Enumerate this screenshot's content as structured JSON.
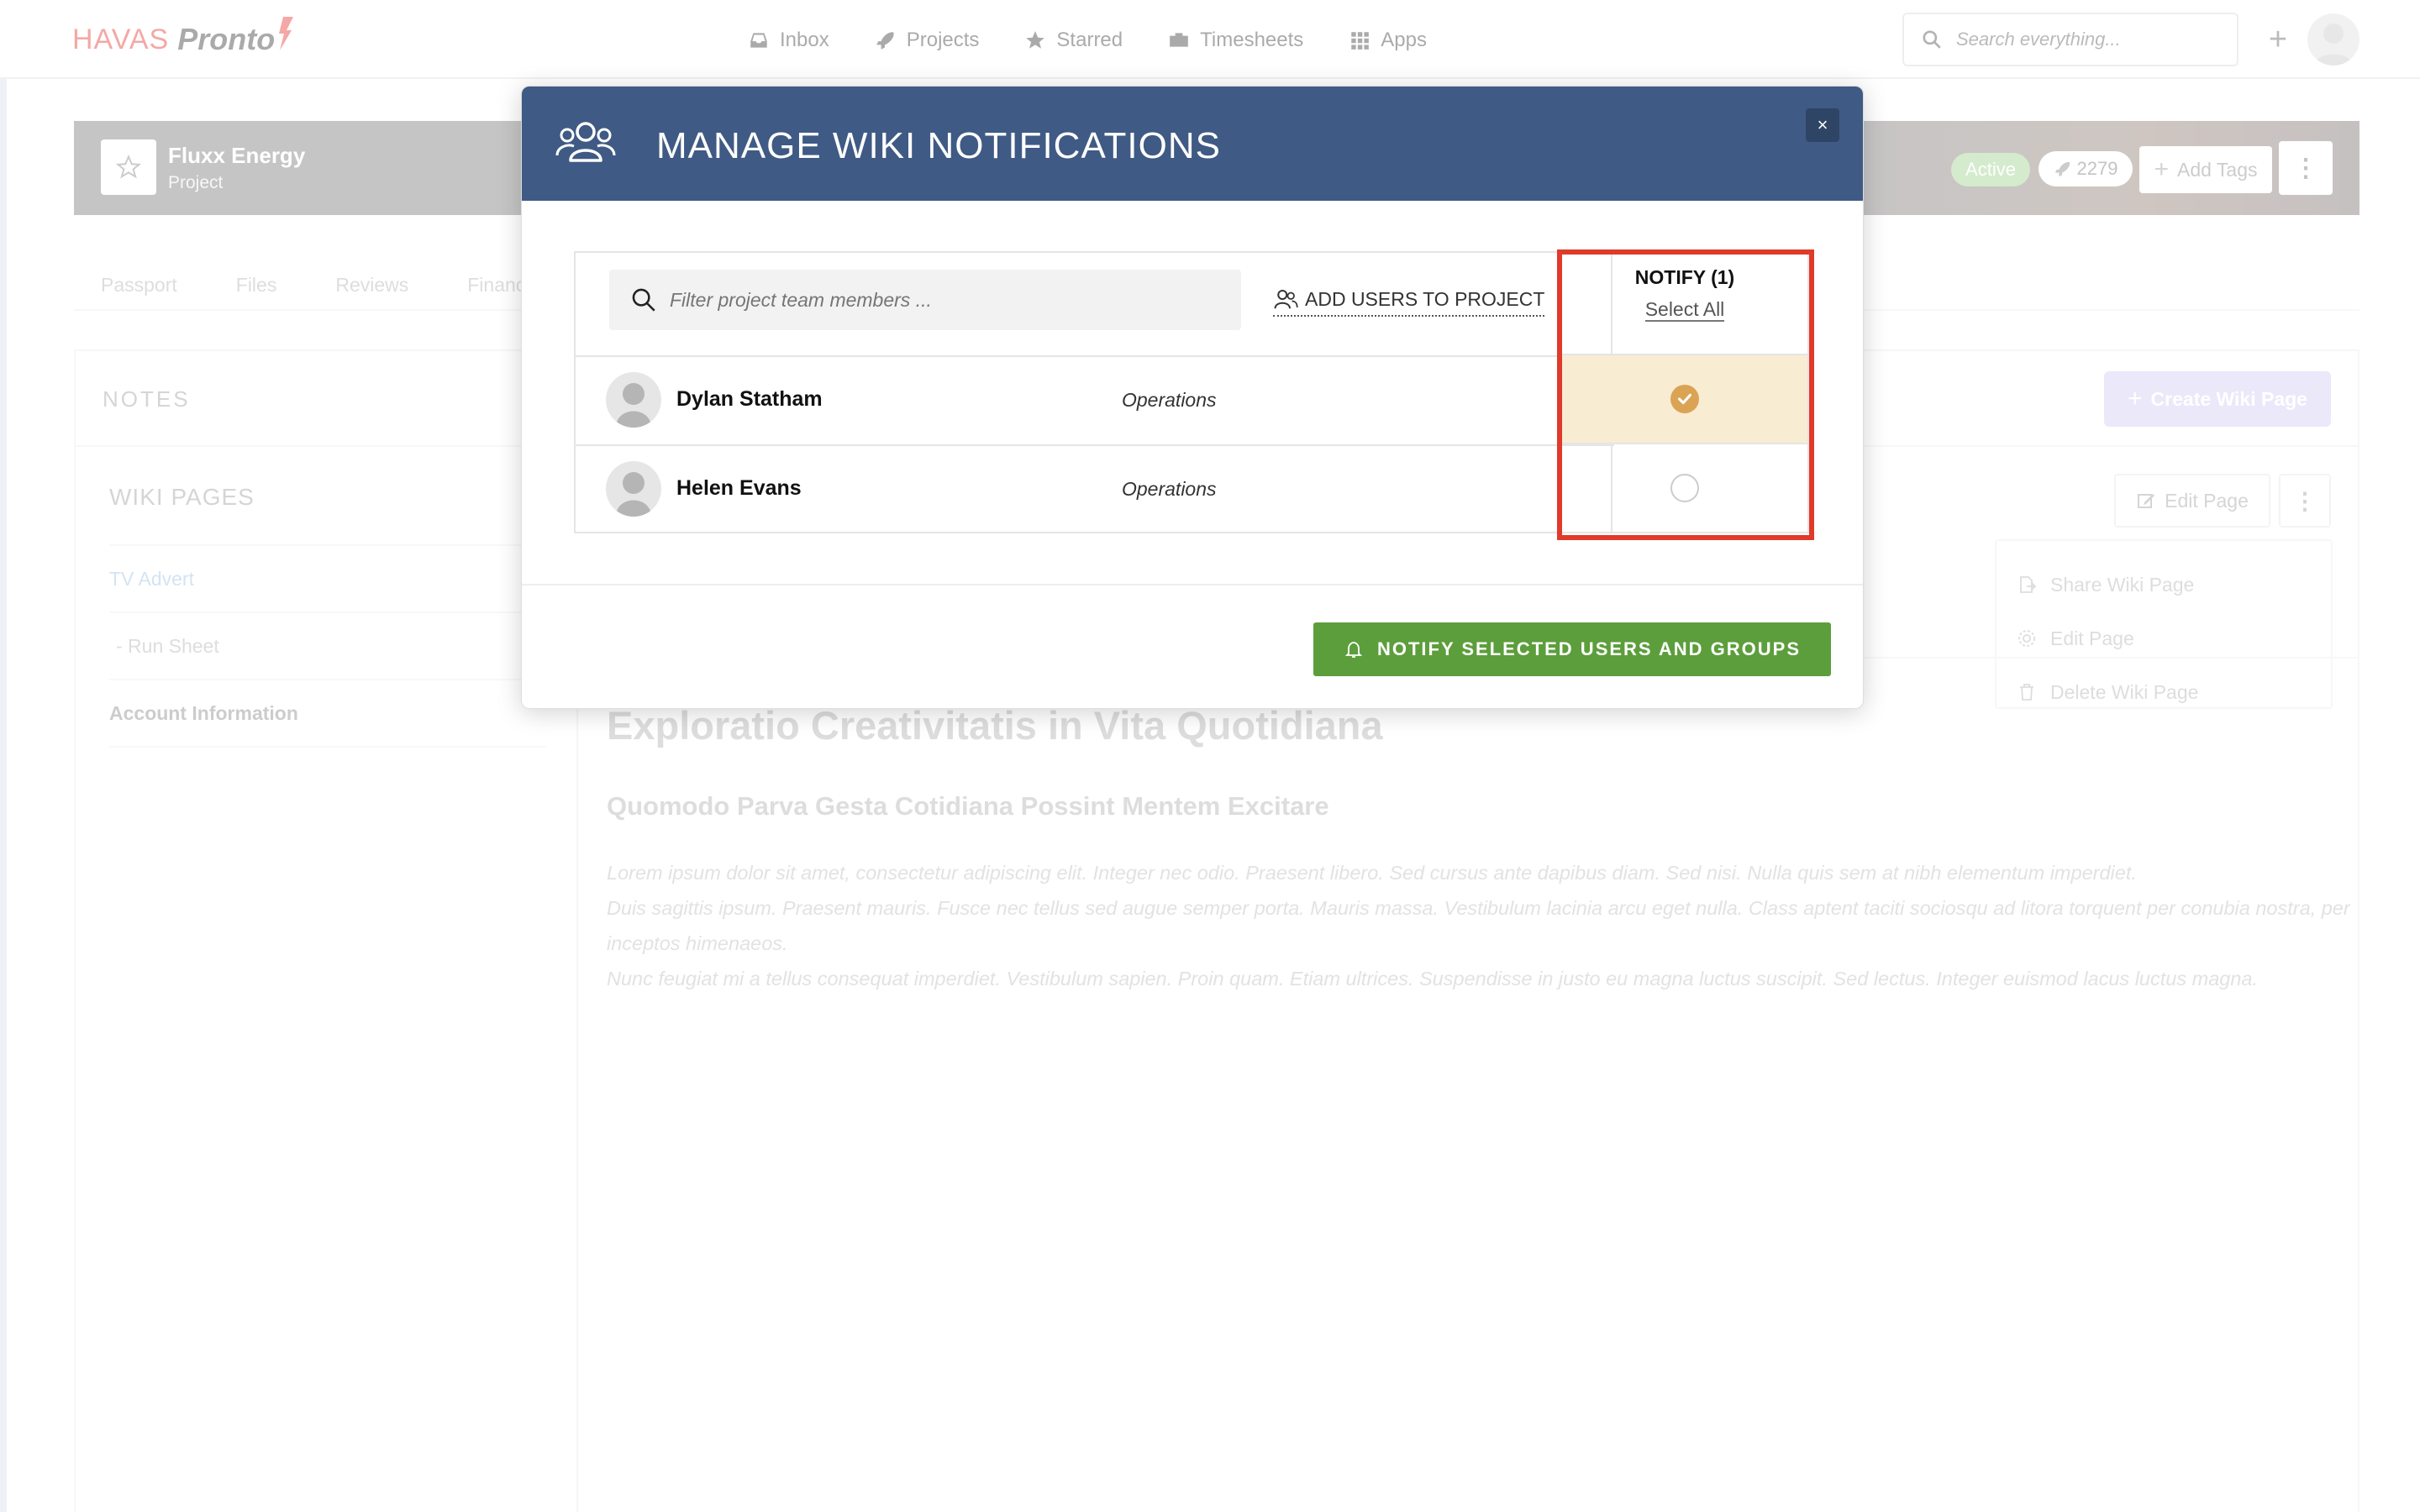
{
  "topnav": {
    "logo_havas": "HAVAS",
    "logo_pronto": "Pronto",
    "items": [
      {
        "label": "Inbox",
        "icon": "inbox-icon"
      },
      {
        "label": "Projects",
        "icon": "rocket-icon"
      },
      {
        "label": "Starred",
        "icon": "star-icon"
      },
      {
        "label": "Timesheets",
        "icon": "timesheets-icon"
      },
      {
        "label": "Apps",
        "icon": "apps-grid-icon"
      }
    ],
    "search_placeholder": "Search everything...",
    "plus_label": "+"
  },
  "project": {
    "title": "Fluxx Energy",
    "subtitle": "Project",
    "status": "Active",
    "count": "2279",
    "add_tags": "Add Tags",
    "more": "⋮"
  },
  "tabs": [
    "Passport",
    "Files",
    "Reviews",
    "Finance"
  ],
  "notes": {
    "heading": "NOTES",
    "wiki_heading": "WIKI PAGES",
    "wiki_items": [
      "TV Advert",
      "- Run Sheet",
      "Account Information"
    ],
    "create_wiki": "Create Wiki Page",
    "edit_page": "Edit Page",
    "dropdown": [
      "Share Wiki Page",
      "Edit Page",
      "Delete Wiki Page"
    ]
  },
  "article": {
    "title": "Exploratio Creativitatis in Vita Quotidiana",
    "subtitle": "Quomodo Parva Gesta Cotidiana Possint Mentem Excitare",
    "paragraphs": [
      "Lorem ipsum dolor sit amet, consectetur adipiscing elit. Integer nec odio. Praesent libero. Sed cursus ante dapibus diam. Sed nisi. Nulla quis sem at nibh elementum imperdiet.",
      "Duis sagittis ipsum. Praesent mauris. Fusce nec tellus sed augue semper porta. Mauris massa. Vestibulum lacinia arcu eget nulla. Class aptent taciti sociosqu ad litora torquent per conubia nostra, per inceptos himenaeos.",
      "Nunc feugiat mi a tellus consequat imperdiet. Vestibulum sapien. Proin quam. Etiam ultrices. Suspendisse in justo eu magna luctus suscipit. Sed lectus. Integer euismod lacus luctus magna."
    ]
  },
  "modal": {
    "title": "MANAGE WIKI NOTIFICATIONS",
    "close": "×",
    "filter_placeholder": "Filter project team members ...",
    "add_users": "ADD USERS TO PROJECT",
    "notify_header": "NOTIFY (1)",
    "select_all": "Select All",
    "members": [
      {
        "name": "Dylan Statham",
        "department": "Operations",
        "notify": true
      },
      {
        "name": "Helen Evans",
        "department": "Operations",
        "notify": false
      }
    ],
    "notify_button": "NOTIFY SELECTED USERS AND GROUPS"
  },
  "colors": {
    "modal_header": "#3f5a84",
    "notify_button": "#5c9e3b",
    "selected_row": "#f8ecd3",
    "checkmark": "#dba354",
    "highlight": "#e03a2a",
    "logo_red": "#e8504a"
  }
}
